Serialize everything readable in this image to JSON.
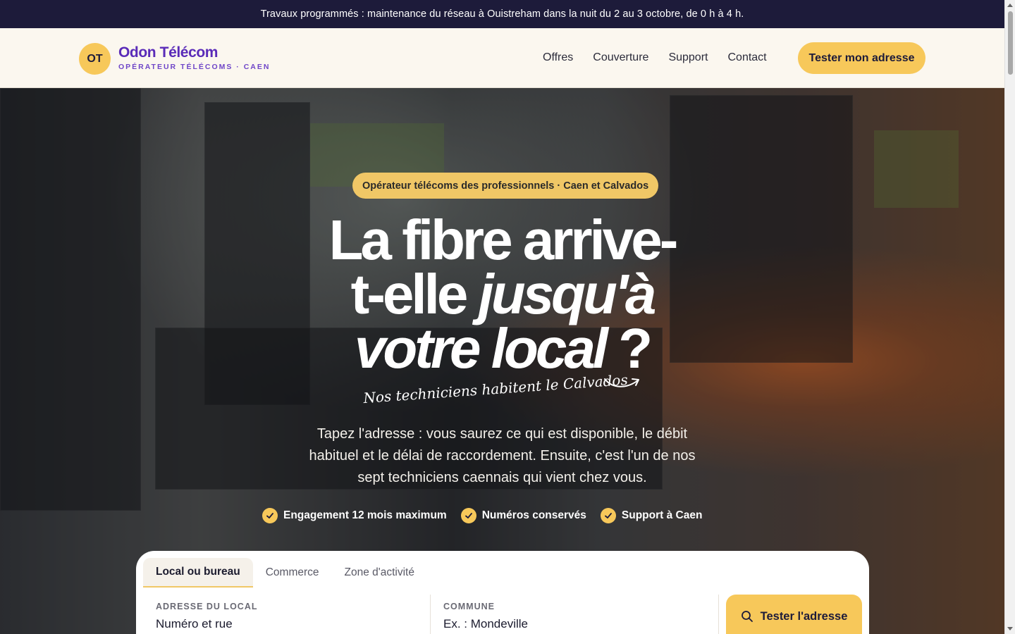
{
  "announcement": "Travaux programmés : maintenance du réseau à Ouistreham dans la nuit du 2 au 3 octobre, de 0 h à 4 h.",
  "brand": {
    "initials": "OT",
    "name": "Odon Télécom",
    "subtitle": "OPÉRATEUR TÉLÉCOMS · CAEN"
  },
  "nav": {
    "items": [
      "Offres",
      "Couverture",
      "Support",
      "Contact"
    ],
    "cta": "Tester mon adresse"
  },
  "hero": {
    "pill": "Opérateur télécoms des professionnels · Caen et Calvados",
    "title_line1": "La fibre arrive-",
    "title_line2_plain": "t-elle ",
    "title_line2_italic": "jusqu'à",
    "title_line3_italic": "votre local",
    "title_line3_plain": " ?",
    "tagline": "Nos techniciens habitent le Calvados",
    "lead": "Tapez l'adresse : vous saurez ce qui est disponible, le débit habituel et le délai de raccordement. Ensuite, c'est l'un de nos sept techniciens caennais qui vient chez vous.",
    "checks": [
      "Engagement 12 mois maximum",
      "Numéros conservés",
      "Support à Caen"
    ]
  },
  "search": {
    "tabs": [
      "Local ou bureau",
      "Commerce",
      "Zone d'activité"
    ],
    "active_tab": "Local ou bureau",
    "address_label": "ADRESSE DU LOCAL",
    "address_placeholder": "Numéro et rue",
    "city_label": "COMMUNE",
    "city_placeholder": "Ex. : Mondeville",
    "button": "Tester l'adresse"
  },
  "colors": {
    "accent": "#f7c85a",
    "brand": "#5a2bb8",
    "topbar": "#1d1b3a"
  }
}
